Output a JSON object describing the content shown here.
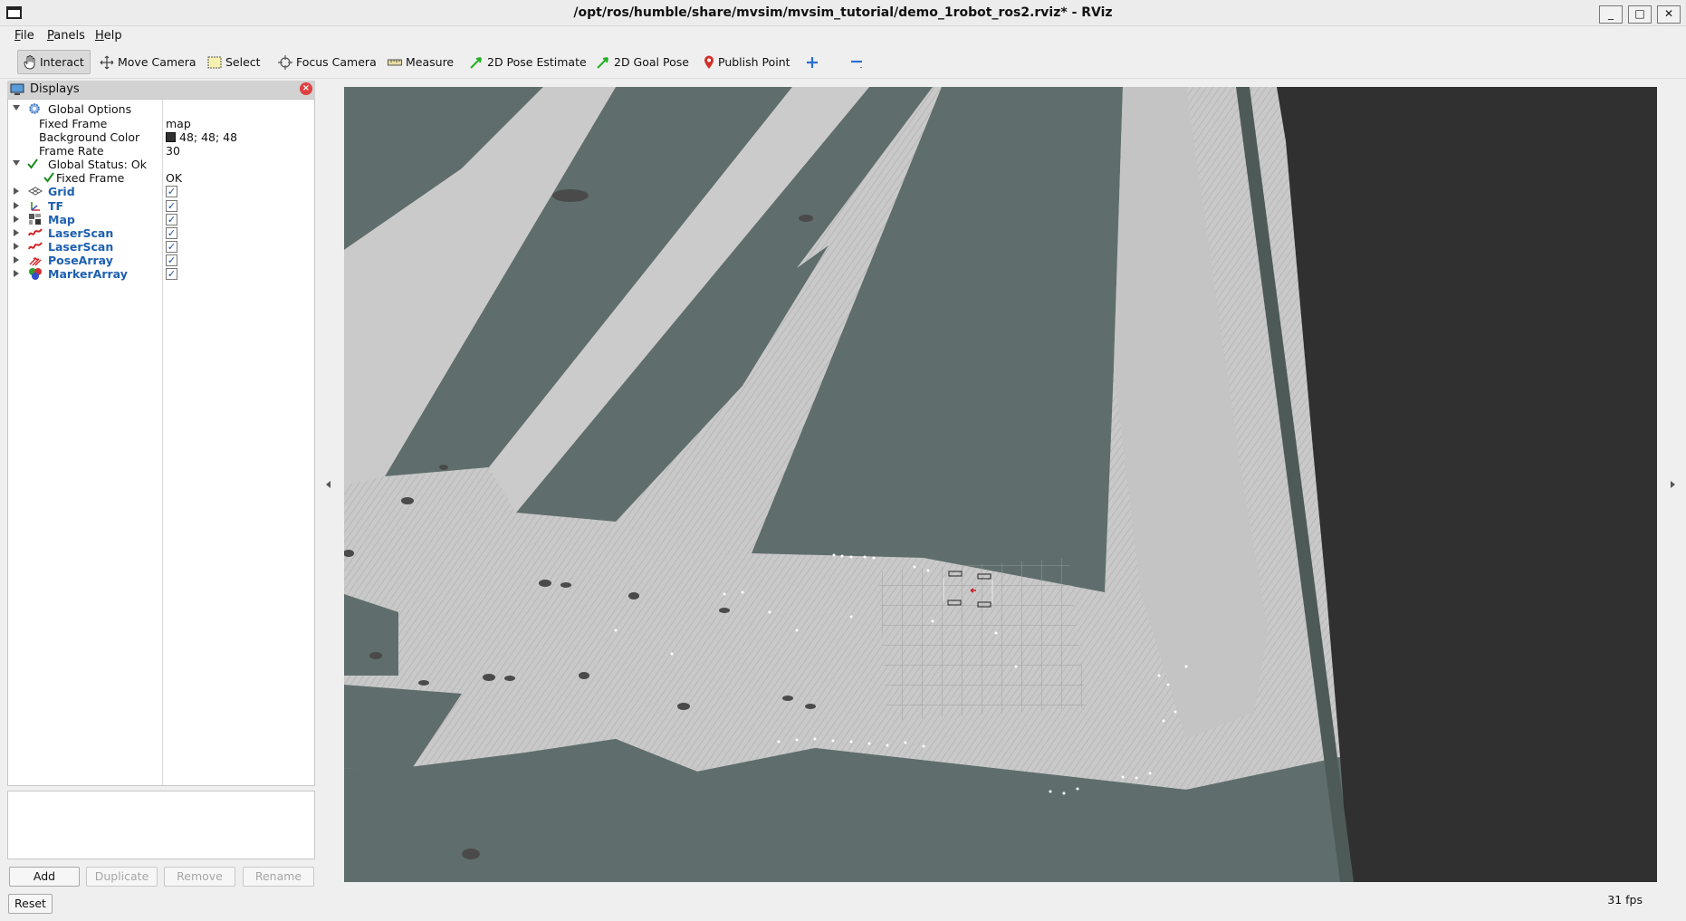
{
  "window": {
    "title": "/opt/ros/humble/share/mvsim/mvsim_tutorial/demo_1robot_ros2.rviz* - RViz",
    "min_label": "_",
    "max_label": "□",
    "close_label": "✕"
  },
  "menubar": {
    "items": [
      {
        "ul": "F",
        "rest": "ile"
      },
      {
        "ul": "P",
        "rest": "anels"
      },
      {
        "ul": "H",
        "rest": "elp"
      }
    ]
  },
  "toolbar": {
    "tools": [
      {
        "label": "Interact",
        "icon": "hand-icon"
      },
      {
        "label": "Move Camera",
        "icon": "move-camera-icon"
      },
      {
        "label": "Select",
        "icon": "select-icon"
      },
      {
        "label": "Focus Camera",
        "icon": "focus-camera-icon"
      },
      {
        "label": "Measure",
        "icon": "ruler-icon"
      },
      {
        "label": "2D Pose Estimate",
        "icon": "pose-arrow-icon"
      },
      {
        "label": "2D Goal Pose",
        "icon": "goal-arrow-icon"
      },
      {
        "label": "Publish Point",
        "icon": "map-pin-icon"
      }
    ]
  },
  "displays": {
    "title": "Displays",
    "global_options": {
      "label": "Global Options",
      "props": [
        {
          "name": "Fixed Frame",
          "value": "map"
        },
        {
          "name": "Background Color",
          "value": "48; 48; 48"
        },
        {
          "name": "Frame Rate",
          "value": "30"
        }
      ]
    },
    "global_status": {
      "label": "Global Status: Ok",
      "child_name": "Fixed Frame",
      "child_value": "OK"
    },
    "items": [
      {
        "label": "Grid",
        "checked": "✓",
        "icon": "grid-icon"
      },
      {
        "label": "TF",
        "checked": "✓",
        "icon": "tf-icon"
      },
      {
        "label": "Map",
        "checked": "✓",
        "icon": "map-icon"
      },
      {
        "label": "LaserScan",
        "checked": "✓",
        "icon": "laserscan-icon"
      },
      {
        "label": "LaserScan",
        "checked": "✓",
        "icon": "laserscan-icon"
      },
      {
        "label": "PoseArray",
        "checked": "✓",
        "icon": "posearray-icon"
      },
      {
        "label": "MarkerArray",
        "checked": "✓",
        "icon": "markerarray-icon"
      }
    ],
    "buttons": {
      "add": "Add",
      "duplicate": "Duplicate",
      "remove": "Remove",
      "rename": "Rename"
    },
    "reset": "Reset"
  },
  "status": {
    "fps": "31 fps"
  },
  "colors": {
    "background": "#303030",
    "map_free": "#cfcfcf",
    "map_occupied": "#5f6f6d"
  }
}
